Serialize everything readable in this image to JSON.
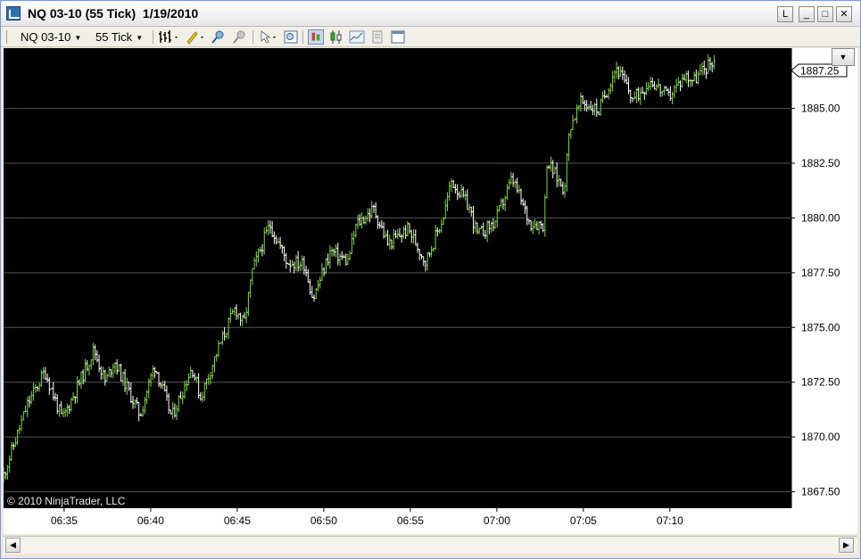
{
  "window": {
    "title": "NQ 03-10 (55 Tick)  1/19/2010",
    "buttons": {
      "l": "L",
      "minimize": "_",
      "maximize": "□",
      "close": "✕"
    }
  },
  "toolbar": {
    "instrument": "NQ 03-10",
    "interval": "55 Tick",
    "icons": [
      "bar-type-icon",
      "drawing-pencil-icon",
      "zoom-in-icon",
      "zoom-out-icon",
      "cursor-icon",
      "properties-icon",
      "chart-style-icon",
      "candlestick-icon",
      "line-icon",
      "data-box-icon",
      "toggle-panel-icon"
    ]
  },
  "chart": {
    "copyright": "© 2010 NinjaTrader, LLC",
    "last_price_label": "1887.25"
  },
  "chart_data": {
    "type": "ohlc",
    "title": "",
    "xlabel": "",
    "ylabel": "",
    "ylim": [
      1866.75,
      1887.75
    ],
    "y_ticks": [
      "1867.50",
      "1870.00",
      "1872.50",
      "1875.00",
      "1877.50",
      "1880.00",
      "1882.50",
      "1885.00"
    ],
    "x_ticks": [
      "06:35",
      "06:40",
      "06:45",
      "06:50",
      "06:55",
      "07:00",
      "07:05",
      "07:10"
    ],
    "x_range_minutes": [
      "06:31:30",
      "07:20:50"
    ],
    "grid": true,
    "colors": {
      "background": "#000000",
      "up_bar": "#7ddc3a",
      "down_bar": "#ffffff",
      "grid": "#555555",
      "axis_text": "#000000"
    },
    "series": [
      {
        "price_path": [
          [
            "06:31:30",
            1868.0
          ],
          [
            "06:33:00",
            1871.5
          ],
          [
            "06:34:00",
            1873.0
          ],
          [
            "06:35:00",
            1870.8
          ],
          [
            "06:36:00",
            1872.5
          ],
          [
            "06:36:50",
            1874.0
          ],
          [
            "06:37:30",
            1872.5
          ],
          [
            "06:38:00",
            1873.5
          ],
          [
            "06:39:30",
            1871.0
          ],
          [
            "06:40:20",
            1873.3
          ],
          [
            "06:41:20",
            1870.9
          ],
          [
            "06:42:30",
            1873.2
          ],
          [
            "06:43:00",
            1871.8
          ],
          [
            "06:44:00",
            1874.0
          ],
          [
            "06:45:00",
            1875.9
          ],
          [
            "06:45:30",
            1875.1
          ],
          [
            "06:46:00",
            1877.6
          ],
          [
            "06:47:00",
            1879.7
          ],
          [
            "06:48:00",
            1878.0
          ],
          [
            "06:49:00",
            1877.9
          ],
          [
            "06:49:30",
            1876.3
          ],
          [
            "06:50:30",
            1878.5
          ],
          [
            "06:51:30",
            1878.0
          ],
          [
            "06:52:00",
            1879.7
          ],
          [
            "06:53:00",
            1880.4
          ],
          [
            "06:53:50",
            1878.8
          ],
          [
            "06:55:00",
            1879.5
          ],
          [
            "06:56:00",
            1878.0
          ],
          [
            "06:57:00",
            1880.0
          ],
          [
            "06:57:30",
            1881.7
          ],
          [
            "06:58:30",
            1880.5
          ],
          [
            "06:59:00",
            1879.2
          ],
          [
            "07:00:00",
            1879.8
          ],
          [
            "07:01:00",
            1881.8
          ],
          [
            "07:02:00",
            1879.8
          ],
          [
            "07:02:50",
            1879.7
          ],
          [
            "07:03:00",
            1882.6
          ],
          [
            "07:04:00",
            1881.3
          ],
          [
            "07:04:20",
            1884.2
          ],
          [
            "07:05:00",
            1885.3
          ],
          [
            "07:06:00",
            1884.9
          ],
          [
            "07:07:00",
            1886.9
          ],
          [
            "07:08:00",
            1885.4
          ],
          [
            "07:09:00",
            1886.3
          ],
          [
            "07:10:00",
            1885.5
          ],
          [
            "07:11:00",
            1886.5
          ],
          [
            "07:11:30",
            1886.3
          ],
          [
            "07:12:40",
            1887.25
          ]
        ]
      }
    ]
  }
}
